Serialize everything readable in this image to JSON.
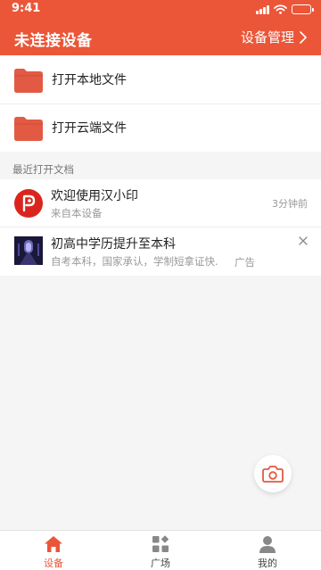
{
  "status_bar": {
    "time": "9:41"
  },
  "header": {
    "title": "未连接设备",
    "manage_label": "设备管理"
  },
  "file_actions": [
    {
      "label": "打开本地文件",
      "icon": "folder-icon"
    },
    {
      "label": "打开云端文件",
      "icon": "folder-icon"
    }
  ],
  "recent": {
    "section_label": "最近打开文档",
    "items": [
      {
        "title": "欢迎使用汉小印",
        "subtitle": "来自本设备",
        "time": "3分钟前",
        "icon": "app-logo-icon"
      }
    ],
    "ad": {
      "title": "初高中学历提升至本科",
      "subtitle": "自考本科，国家承认，学制短拿证快.",
      "tag": "广告"
    }
  },
  "fab": {
    "icon": "camera-icon"
  },
  "tabbar": [
    {
      "label": "设备",
      "icon": "home-icon",
      "active": true
    },
    {
      "label": "广场",
      "icon": "grid-icon",
      "active": false
    },
    {
      "label": "我的",
      "icon": "user-icon",
      "active": false
    }
  ],
  "colors": {
    "accent": "#eb5638",
    "background": "#f5f5f5",
    "folder": "#e25a43"
  }
}
